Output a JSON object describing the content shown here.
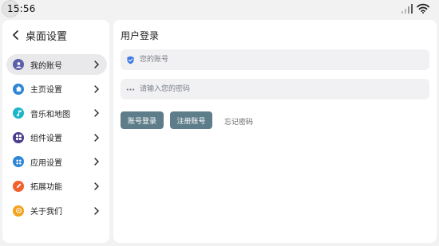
{
  "status_bar": {
    "time": "15:56",
    "icons": [
      "signal-icon",
      "wifi-icon"
    ]
  },
  "sidebar": {
    "back_icon": "chevron-left-icon",
    "title": "桌面设置",
    "items": [
      {
        "label": "我的账号",
        "icon": "user-icon",
        "color": "#5b5fa8",
        "active": true
      },
      {
        "label": "主页设置",
        "icon": "home-icon",
        "color": "#2f86d6",
        "active": false
      },
      {
        "label": "音乐和地图",
        "icon": "music-icon",
        "color": "#1eb5c9",
        "active": false
      },
      {
        "label": "组件设置",
        "icon": "widget-icon",
        "color": "#4a3f8f",
        "active": false
      },
      {
        "label": "应用设置",
        "icon": "apps-icon",
        "color": "#2f86d6",
        "active": false
      },
      {
        "label": "拓展功能",
        "icon": "pencil-icon",
        "color": "#f2602d",
        "active": false
      },
      {
        "label": "关于我们",
        "icon": "info-icon",
        "color": "#f2a21e",
        "active": false
      }
    ]
  },
  "main": {
    "title": "用户登录",
    "account_field": {
      "placeholder": "您的账号",
      "value": "",
      "icon": "shield-icon",
      "icon_color": "#3d7be0"
    },
    "password_field": {
      "placeholder": "请输入您的密码",
      "value": "",
      "icon": "password-dots-icon"
    },
    "login_button": "账号登录",
    "register_button": "注册账号",
    "forgot_link": "忘记密码",
    "button_color": "#5e7d8a"
  }
}
